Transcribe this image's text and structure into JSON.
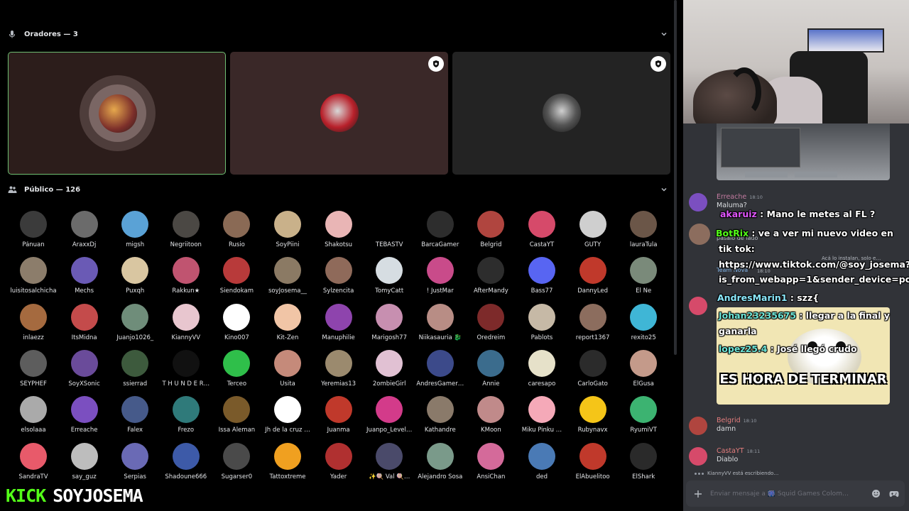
{
  "stage": {
    "speakers_header": "Oradores — 3",
    "audience_header": "Público — 126",
    "speakers": [
      {
        "name": "speaker-1",
        "ring": true,
        "moderator_badge": false
      },
      {
        "name": "speaker-2",
        "ring": false,
        "moderator_badge": true
      },
      {
        "name": "speaker-3",
        "ring": false,
        "moderator_badge": true
      }
    ],
    "audience": [
      [
        "Pánuan",
        "AraxxDj",
        "migsh",
        "Negriitoon",
        "Rusio",
        "SoyPiini",
        "Shakotsu",
        "TEBASTV",
        "BarcaGamer",
        "Belgrid",
        "CastaYT",
        "GUTY",
        "lauraTula"
      ],
      [
        "luisitosalchicha",
        "Mechs",
        "Puxqh",
        "Rakkun★",
        "Siendokam",
        "soyJosema__",
        "Sylzencita",
        "TomyCatt",
        "! JustMar",
        "AfterMandy",
        "Bass77",
        "DannyLed",
        "El Ñe"
      ],
      [
        "inlaezz",
        "ItsMidna",
        "Juanjo1026_",
        "KiannyVV",
        "Kino007",
        "Kit-Zen",
        "Manuphilie",
        "Marigosh77",
        "Niikasauria 🐉",
        "Oredreim",
        "Pablots",
        "report1367",
        "rexito25"
      ],
      [
        "SEYPHEF",
        "SoyXSonic",
        "ssierrad",
        "T H U N D E R…",
        "Terceo",
        "Usita",
        "Yeremias13",
        "2ombieGirl",
        "AndresGamer…",
        "Annie",
        "caresapo",
        "CarloGato",
        "ElGusa"
      ],
      [
        "elsolaaa",
        "Erreache",
        "Falex",
        "Frezo",
        "Issa Aleman",
        "Jh de la cruz …",
        "Juanma",
        "Juanpo_Level…",
        "Kathandre",
        "KMoon",
        "Miku Pinku …",
        "Rubynavx",
        "RyumiVT"
      ],
      [
        "SandraTV",
        "say_guz",
        "Serpias",
        "Shadoune666",
        "Sugarser0",
        "Tattoxtreme",
        "Yader",
        "✨🍭 Val 🍭…",
        "Alejandro Sosa",
        "AnsiChan",
        "ded",
        "ElAbuelitoo",
        "ElShark"
      ]
    ],
    "avatar_colors": [
      [
        "#3b3b3b",
        "#6b6b6b",
        "#5aa2d6",
        "#4b4844",
        "#8a6a55",
        "#c9b18a",
        "#e9b5b5",
        "#000000",
        "#2d2d2d",
        "#b0453f",
        "#d64a6a",
        "#cfcfcf",
        "#6b5648"
      ],
      [
        "#8c7d6b",
        "#6a5ab5",
        "#d9c6a1",
        "#c05470",
        "#b83a3a",
        "#8b7a64",
        "#8f6a5a",
        "#d6dde2",
        "#c94b8a",
        "#2d2d2d",
        "#5865f2",
        "#c0392b",
        "#7a8a7a"
      ],
      [
        "#a56a3f",
        "#c44b4b",
        "#6f8d7a",
        "#e8c6cf",
        "#ffffff",
        "#f1c5a6",
        "#8e44ad",
        "#c78fb0",
        "#b88d85",
        "#7d2a2a",
        "#c6b9a6",
        "#8c6d5e",
        "#3fb6d6"
      ],
      [
        "#5d5d5d",
        "#6a4b9a",
        "#3d5a3d",
        "#111111",
        "#2fbf4a",
        "#c58a7a",
        "#9b8a6e",
        "#e1c1d3",
        "#3c4a8a",
        "#3b6c8d",
        "#e6e1c9",
        "#2b2b2b",
        "#c49a8a"
      ],
      [
        "#aaaaaa",
        "#7b4fc0",
        "#465a8a",
        "#2f7a7a",
        "#7a5a2a",
        "#ffffff",
        "#c0392b",
        "#d33b8a",
        "#8a7a6a",
        "#c08a8a",
        "#f5a9b8",
        "#f5c518",
        "#3cb371"
      ],
      [
        "#e85a6a",
        "#bdbdbd",
        "#6a6ab5",
        "#3d5aa8",
        "#4a4a4a",
        "#f0a020",
        "#b03030",
        "#4a4a6a",
        "#7a9a8a",
        "#d46a9a",
        "#4a7ab5",
        "#c0392b",
        "#2a2a2a"
      ]
    ],
    "overlay": {
      "brand": "KICK",
      "user": "SOYJOSEMA"
    }
  },
  "chat": {
    "messages": [
      {
        "user": "Erreache",
        "time": "18:10",
        "text": "Maluma?",
        "color": "#c27ba0",
        "avatar": "#7b4fc0"
      },
      {
        "user": "Belgrid",
        "time": "18:10",
        "text": "damn",
        "color": "#e67e7e",
        "avatar": "#b0453f"
      },
      {
        "user": "CastaYT",
        "time": "18:11",
        "text": "Diablo",
        "color": "#e67e7e",
        "avatar": "#d64a6a"
      }
    ],
    "overlay_lines": [
      {
        "user": "akaruiz",
        "text": " : Mano le metes al FL ?"
      },
      {
        "user": "BotRix",
        "text": " : ve a ver mi nuevo video en"
      },
      {
        "user": "",
        "text": "tik tok:"
      },
      {
        "user": "",
        "text": "https://www.tiktok.com/@soy_josema?"
      },
      {
        "user": "",
        "text": "is_from_webapp=1&sender_device=pc"
      },
      {
        "user": "AndresMarin1",
        "text": " : szz{"
      },
      {
        "user": "Johan23235675",
        "text": " : llegar a la final y"
      },
      {
        "user": "",
        "text": "ganarla"
      },
      {
        "user": "lopez25.4",
        "text": " : José llegó crudo"
      }
    ],
    "faint_texts": [
      "pasalo de lado",
      "Acá lo instalan, solo e…",
      "Team Nova",
      "18:10"
    ],
    "meme_text": "ES HORA DE TERMINAR",
    "typing": "KiannyVV está escribiendo…",
    "input_placeholder": "Enviar mensaje a 🎆 Squid Games Colom…"
  }
}
